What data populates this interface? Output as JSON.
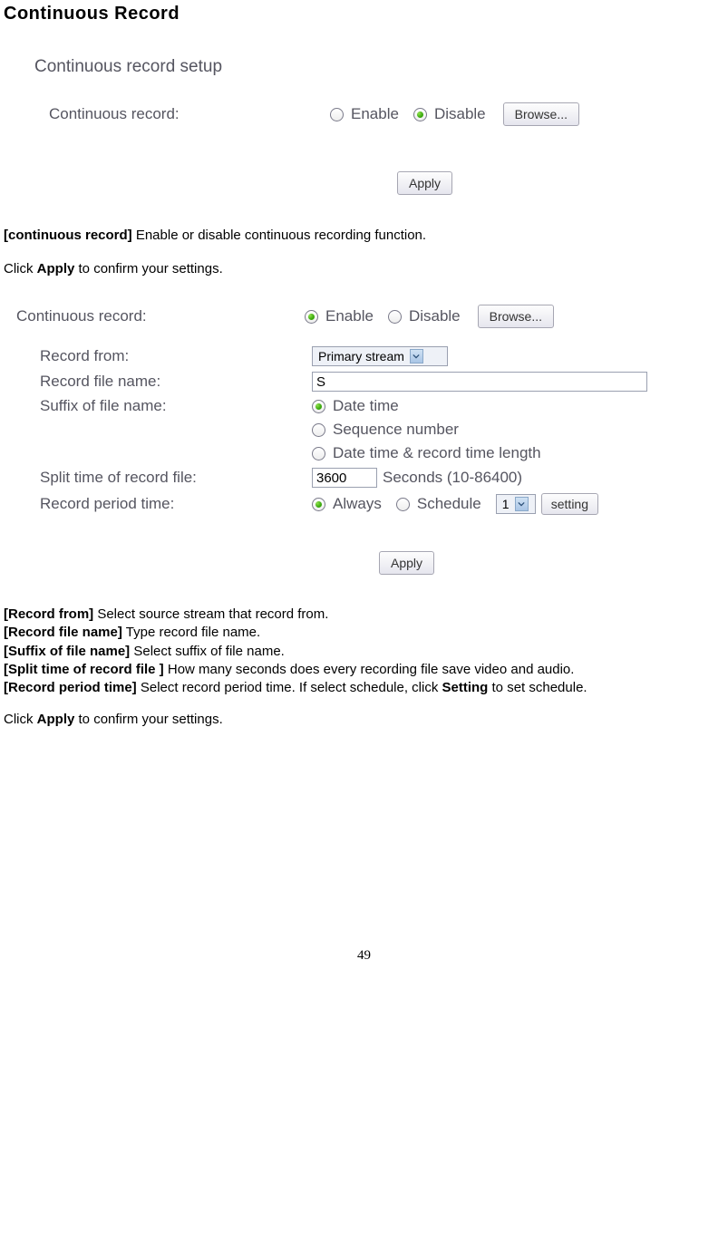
{
  "title": "Continuous Record",
  "panel1": {
    "heading": "Continuous record setup",
    "cr_label": "Continuous record:",
    "enable": "Enable",
    "disable": "Disable",
    "browse": "Browse...",
    "apply": "Apply"
  },
  "desc1": {
    "key": "[continuous record]",
    "text": " Enable or disable continuous recording function."
  },
  "click_apply_1": "Click ",
  "apply_bold": "Apply",
  "click_apply_tail": " to confirm your settings.",
  "panel2": {
    "cr_label": "Continuous record:",
    "enable": "Enable",
    "disable": "Disable",
    "browse": "Browse...",
    "record_from_label": "Record from:",
    "record_from_value": "Primary stream",
    "file_name_label": "Record file name:",
    "file_name_value": "S",
    "suffix_label": "Suffix of file name:",
    "suffix_opt1": "Date time",
    "suffix_opt2": "Sequence number",
    "suffix_opt3": "Date time & record time length",
    "split_label": "Split time of record file:",
    "split_value": "3600",
    "split_hint": "Seconds (10-86400)",
    "period_label": "Record period time:",
    "period_always": "Always",
    "period_schedule": "Schedule",
    "schedule_sel": "1",
    "setting": "setting",
    "apply": "Apply"
  },
  "desc2": [
    {
      "k": "[Record from]",
      "t": " Select source stream that record from."
    },
    {
      "k": "[Record file name]",
      "t": " Type record file name."
    },
    {
      "k": "[Suffix of file name]",
      "t": " Select suffix of file name."
    },
    {
      "k": "[Split time of record file ]",
      "t": " How many seconds does every recording file save video and audio."
    },
    {
      "k": "[Record period time]",
      "t": " Select record period time. If select schedule, click "
    },
    {
      "k2": "Setting",
      "t2": " to set schedule."
    }
  ],
  "page_number": "49"
}
